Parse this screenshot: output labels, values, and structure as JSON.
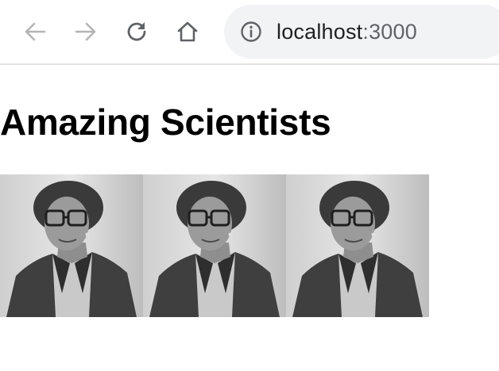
{
  "browser": {
    "url_host": "localhost",
    "url_port": ":3000",
    "icons": [
      "back-arrow-icon",
      "forward-arrow-icon",
      "reload-icon",
      "home-icon",
      "site-info-icon"
    ]
  },
  "page": {
    "heading": "Amazing Scientists",
    "photos": [
      {
        "subject": "scientist-portrait"
      },
      {
        "subject": "scientist-portrait"
      },
      {
        "subject": "scientist-portrait"
      }
    ]
  }
}
